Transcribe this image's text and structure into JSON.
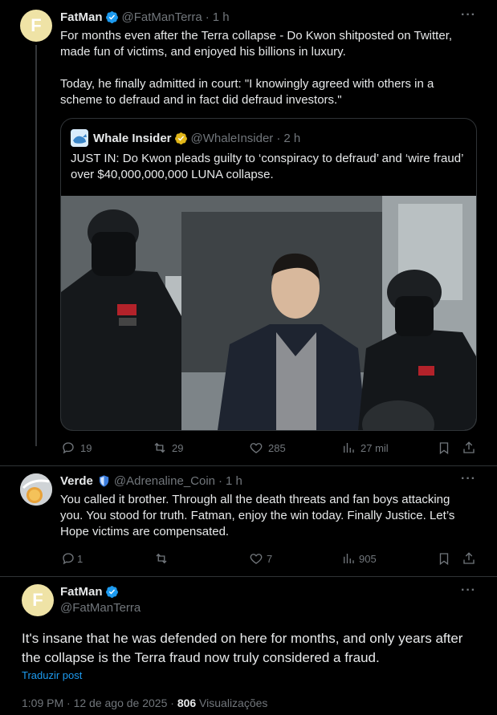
{
  "post1": {
    "author_name": "FatMan",
    "author_handle": "@FatManTerra",
    "time": "1 h",
    "avatar_letter": "F",
    "text_p1": "For months even after the Terra collapse - Do Kwon shitposted on Twitter, made fun of victims, and enjoyed his billions in luxury.",
    "text_p2": "Today, he finally admitted in court: \"I knowingly agreed with others in a scheme to defraud and in fact did defraud investors.\"",
    "quote": {
      "author_name": "Whale Insider",
      "author_handle": "@WhaleInsider",
      "time": "2 h",
      "text": "JUST IN: Do Kwon pleads guilty to ‘conspiracy to defraud’ and ‘wire fraud’ over $40,000,000,000 LUNA collapse."
    },
    "stats": {
      "replies": "19",
      "reposts": "29",
      "likes": "285",
      "views": "27 mil"
    }
  },
  "post2": {
    "author_name": "Verde",
    "author_handle": "@Adrenaline_Coin",
    "time": "1 h",
    "text": "You called it brother. Through all the death threats and fan boys attacking you. You stood for truth. Fatman, enjoy the win today. Finally Justice. Let’s Hope victims are compensated.",
    "stats": {
      "replies": "1",
      "reposts": "",
      "likes": "7",
      "views": "905"
    }
  },
  "post3": {
    "author_name": "FatMan",
    "author_handle": "@FatManTerra",
    "avatar_letter": "F",
    "text": "It's insane that he was defended on here for months, and only years after the collapse is the Terra fraud now truly considered a fraud.",
    "translate_link": "Traduzir post",
    "timestamp": "1:09 PM · 12 de ago de 2025 · ",
    "views_count": "806",
    "views_label": " Visualizações"
  },
  "separator": "·",
  "colors": {
    "accent": "#1d9bf0",
    "muted": "#71767b",
    "gold": "#e2b719",
    "border": "#2f3336"
  },
  "icons": [
    "verified-badge-icon",
    "gold-verified-icon",
    "shield-icon",
    "reply-icon",
    "repost-icon",
    "like-icon",
    "views-icon",
    "bookmark-icon",
    "share-icon",
    "more-icon"
  ]
}
